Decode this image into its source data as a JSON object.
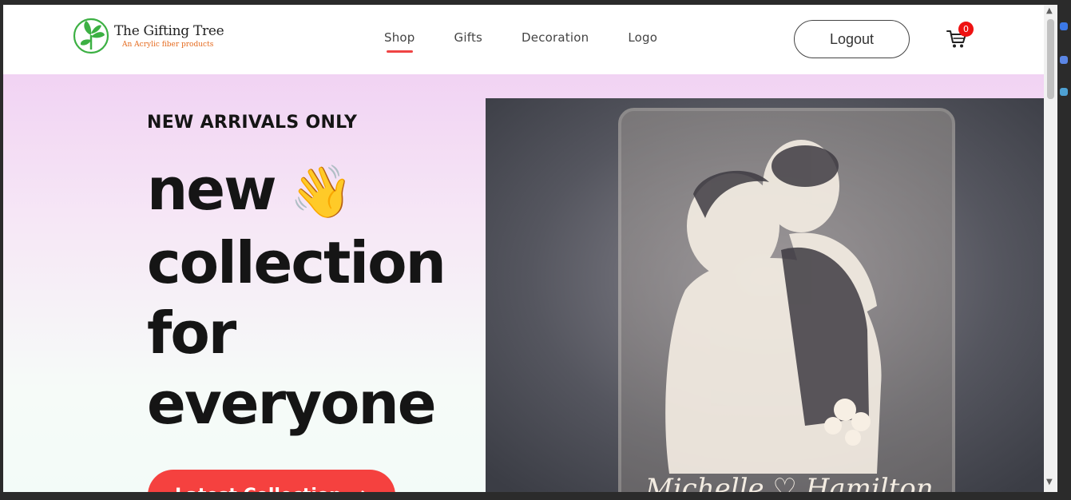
{
  "brand": {
    "name": "The Gifting Tree",
    "tagline": "An Acrylic fiber products"
  },
  "nav": {
    "items": [
      {
        "label": "Shop",
        "active": true
      },
      {
        "label": "Gifts",
        "active": false
      },
      {
        "label": "Decoration",
        "active": false
      },
      {
        "label": "Logo",
        "active": false
      }
    ]
  },
  "header": {
    "logout_label": "Logout",
    "cart_icon": "cart-icon",
    "cart_count": "0"
  },
  "hero": {
    "eyebrow": "NEW ARRIVALS ONLY",
    "headline_line1": "new",
    "headline_emoji": "👋",
    "headline_line2": "collection",
    "headline_line3": "for",
    "headline_line4": "everyone",
    "cta_label": "Latest Collection",
    "cta_icon": "arrow-right-icon",
    "image_caption": "Michelle ♡ Hamilton"
  },
  "colors": {
    "accent": "#ef4444",
    "cta": "#f5413f",
    "hero_top": "#f1d3f3",
    "hero_bottom": "#f3fbf8",
    "brand_green": "#3cb043",
    "tagline_orange": "#e56a1e"
  }
}
